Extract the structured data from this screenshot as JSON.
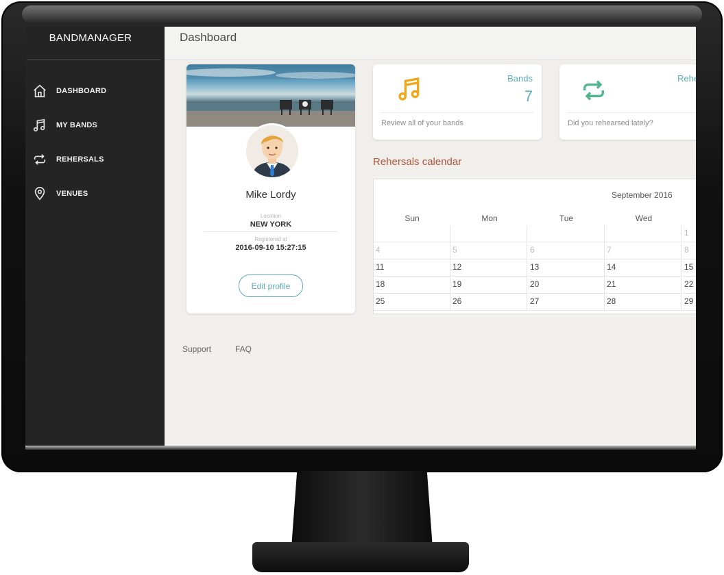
{
  "brand": "BANDMANAGER",
  "sidebar": {
    "items": [
      {
        "label": "DASHBOARD",
        "icon": "home-icon"
      },
      {
        "label": "MY BANDS",
        "icon": "music-note-icon"
      },
      {
        "label": "REHERSALS",
        "icon": "repeat-icon"
      },
      {
        "label": "VENUES",
        "icon": "map-pin-icon"
      }
    ]
  },
  "header": {
    "title": "Dashboard"
  },
  "profile": {
    "name": "Mike Lordy",
    "location_label": "Location",
    "location": "NEW YORK",
    "registered_label": "Registered at",
    "registered": "2016-09-10 15:27:15",
    "edit_label": "Edit profile"
  },
  "stats": [
    {
      "title": "Bands",
      "value": "7",
      "desc": "Review all of your bands",
      "icon": "music-note-icon"
    },
    {
      "title": "Rehe",
      "value": "",
      "desc": "Did you rehearsed lately?",
      "icon": "repeat-icon"
    }
  ],
  "calendar": {
    "title": "Rehersals calendar",
    "month": "September 2016",
    "weekdays": [
      "Sun",
      "Mon",
      "Tue",
      "Wed"
    ],
    "weeks": [
      [
        "",
        "",
        "",
        "",
        "1"
      ],
      [
        "4",
        "5",
        "6",
        "7",
        "8"
      ],
      [
        "11",
        "12",
        "13",
        "14",
        "15"
      ],
      [
        "18",
        "19",
        "20",
        "21",
        "22"
      ],
      [
        "25",
        "26",
        "27",
        "28",
        "29"
      ]
    ]
  },
  "footer": {
    "support": "Support",
    "faq": "FAQ"
  },
  "colors": {
    "accent": "#5aaebc",
    "calendar_title": "#b2543a",
    "music_icon": "#f0a81a",
    "repeat_icon": "#4fb58c",
    "sidebar": "#242424"
  }
}
